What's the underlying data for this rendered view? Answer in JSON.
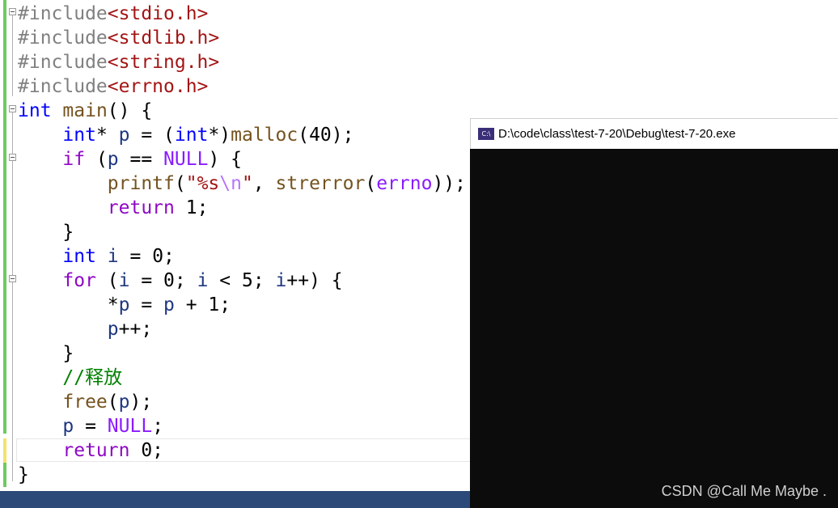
{
  "editor": {
    "lines": [
      {
        "tokens": [
          {
            "t": "#include",
            "c": "inc"
          },
          {
            "t": "<stdio.h>",
            "c": "hdr"
          }
        ]
      },
      {
        "tokens": [
          {
            "t": "#include",
            "c": "inc"
          },
          {
            "t": "<stdlib.h>",
            "c": "hdr"
          }
        ]
      },
      {
        "tokens": [
          {
            "t": "#include",
            "c": "inc"
          },
          {
            "t": "<string.h>",
            "c": "hdr"
          }
        ]
      },
      {
        "tokens": [
          {
            "t": "#include",
            "c": "inc"
          },
          {
            "t": "<errno.h>",
            "c": "hdr"
          }
        ]
      },
      {
        "tokens": [
          {
            "t": "int",
            "c": "kw"
          },
          {
            "t": " "
          },
          {
            "t": "main",
            "c": "fn"
          },
          {
            "t": "() {"
          }
        ]
      },
      {
        "tokens": [
          {
            "t": "    "
          },
          {
            "t": "int",
            "c": "kw"
          },
          {
            "t": "* "
          },
          {
            "t": "p",
            "c": "var"
          },
          {
            "t": " = ("
          },
          {
            "t": "int",
            "c": "kw"
          },
          {
            "t": "*)"
          },
          {
            "t": "malloc",
            "c": "fn"
          },
          {
            "t": "(40);"
          }
        ]
      },
      {
        "tokens": [
          {
            "t": "    "
          },
          {
            "t": "if",
            "c": "kw2"
          },
          {
            "t": " ("
          },
          {
            "t": "p",
            "c": "var"
          },
          {
            "t": " == "
          },
          {
            "t": "NULL",
            "c": "mac"
          },
          {
            "t": ") {"
          }
        ]
      },
      {
        "tokens": [
          {
            "t": "        "
          },
          {
            "t": "printf",
            "c": "fn"
          },
          {
            "t": "("
          },
          {
            "t": "\"%s",
            "c": "str"
          },
          {
            "t": "\\n",
            "c": "esc"
          },
          {
            "t": "\"",
            "c": "str"
          },
          {
            "t": ", "
          },
          {
            "t": "strerror",
            "c": "fn"
          },
          {
            "t": "("
          },
          {
            "t": "errno",
            "c": "mac"
          },
          {
            "t": "));"
          }
        ]
      },
      {
        "tokens": [
          {
            "t": "        "
          },
          {
            "t": "return",
            "c": "kw2"
          },
          {
            "t": " 1;"
          }
        ]
      },
      {
        "tokens": [
          {
            "t": "    }"
          }
        ]
      },
      {
        "tokens": [
          {
            "t": "    "
          },
          {
            "t": "int",
            "c": "kw"
          },
          {
            "t": " "
          },
          {
            "t": "i",
            "c": "var"
          },
          {
            "t": " = 0;"
          }
        ]
      },
      {
        "tokens": [
          {
            "t": "    "
          },
          {
            "t": "for",
            "c": "kw2"
          },
          {
            "t": " ("
          },
          {
            "t": "i",
            "c": "var"
          },
          {
            "t": " = 0; "
          },
          {
            "t": "i",
            "c": "var"
          },
          {
            "t": " < 5; "
          },
          {
            "t": "i",
            "c": "var"
          },
          {
            "t": "++) {"
          }
        ]
      },
      {
        "tokens": [
          {
            "t": "        *"
          },
          {
            "t": "p",
            "c": "var"
          },
          {
            "t": " = "
          },
          {
            "t": "p",
            "c": "var"
          },
          {
            "t": " + 1;"
          }
        ]
      },
      {
        "tokens": [
          {
            "t": "        "
          },
          {
            "t": "p",
            "c": "var"
          },
          {
            "t": "++;"
          }
        ]
      },
      {
        "tokens": [
          {
            "t": "    }"
          }
        ]
      },
      {
        "tokens": [
          {
            "t": "    "
          },
          {
            "t": "//释放",
            "c": "cmt"
          }
        ]
      },
      {
        "tokens": [
          {
            "t": "    "
          },
          {
            "t": "free",
            "c": "fn"
          },
          {
            "t": "("
          },
          {
            "t": "p",
            "c": "var"
          },
          {
            "t": ");"
          }
        ]
      },
      {
        "tokens": [
          {
            "t": "    "
          },
          {
            "t": "p",
            "c": "var"
          },
          {
            "t": " = "
          },
          {
            "t": "NULL",
            "c": "mac"
          },
          {
            "t": ";"
          }
        ]
      },
      {
        "tokens": [
          {
            "t": "    "
          },
          {
            "t": "return",
            "c": "kw2"
          },
          {
            "t": " 0;"
          }
        ]
      },
      {
        "tokens": [
          {
            "t": "}"
          }
        ]
      }
    ]
  },
  "console": {
    "icon_name": "console-app-icon",
    "icon_text": "C:\\",
    "title": "D:\\code\\class\\test-7-20\\Debug\\test-7-20.exe"
  },
  "watermark": "CSDN @Call Me Maybe ."
}
